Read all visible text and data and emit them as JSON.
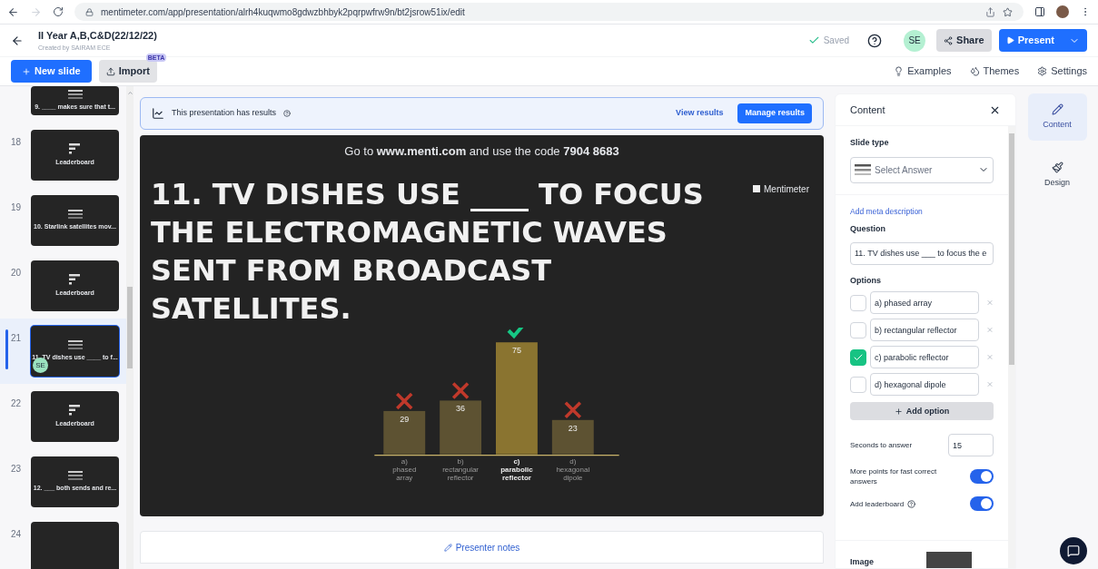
{
  "browser": {
    "url": "mentimeter.com/app/presentation/alrh4kuqwmo8gdwzbhbyk2pqrpwfrw9n/bt2jsrow51ix/edit"
  },
  "header": {
    "title": "II Year A,B,C&D(22/12/22)",
    "subtitle": "Created by SAIRAM ECE",
    "saved": "Saved",
    "avatar": "SE",
    "share": "Share",
    "present": "Present"
  },
  "toolbar": {
    "new_slide": "New slide",
    "import": "Import",
    "import_badge": "BETA",
    "links": [
      "Examples",
      "Themes",
      "Settings"
    ]
  },
  "slides": [
    {
      "title": "9. ____ makes sure that t...",
      "kind": "question",
      "selected": false
    },
    {
      "number": "18",
      "title": "Leaderboard",
      "kind": "leaderboard",
      "selected": false
    },
    {
      "number": "19",
      "title": "10. Starlink satellites mov...",
      "kind": "question",
      "selected": false
    },
    {
      "number": "20",
      "title": "Leaderboard",
      "kind": "leaderboard",
      "selected": false
    },
    {
      "number": "21",
      "title": "11. TV dishes use ____ to f...",
      "kind": "question",
      "selected": true,
      "avatar": "SE"
    },
    {
      "number": "22",
      "title": "Leaderboard",
      "kind": "leaderboard",
      "selected": false
    },
    {
      "number": "23",
      "title": "12. ___ both sends and re...",
      "kind": "question",
      "selected": false
    },
    {
      "number": "24",
      "kind": "blank",
      "selected": false
    }
  ],
  "results_banner": {
    "text": "This presentation has results",
    "view": "View results",
    "manage": "Manage results"
  },
  "slide": {
    "join_prefix": "Go to ",
    "join_site": "www.menti.com",
    "join_mid": " and use the code ",
    "join_code": "7904 8683",
    "brand": "Mentimeter",
    "title": "11. TV DISHES USE ____ TO FOCUS THE ELECTROMAGNETIC WAVES SENT FROM BROADCAST SATELLITES.",
    "markers": [
      {
        "correct": false
      },
      {
        "correct": false
      },
      {
        "correct": true
      },
      {
        "correct": false
      }
    ],
    "chart_data": {
      "type": "bar",
      "categories": [
        "a) phased array",
        "b) rectangular reflector",
        "c) parabolic reflector",
        "d) hexagonal dipole"
      ],
      "values": [
        29,
        36,
        75,
        23
      ],
      "data_labels": true
    }
  },
  "presenter_notes": "Presenter notes",
  "panel": {
    "title": "Content",
    "slide_type_label": "Slide type",
    "slide_type": "Select Answer",
    "meta_link": "Add meta description",
    "question_label": "Question",
    "question": "11. TV dishes use ___ to focus the e",
    "options_label": "Options",
    "options": [
      {
        "text": "a) phased array",
        "checked": false
      },
      {
        "text": "b) rectangular reflector",
        "checked": false
      },
      {
        "text": "c) parabolic reflector",
        "checked": true
      },
      {
        "text": "d) hexagonal dipole",
        "checked": false
      }
    ],
    "add_option": "Add option",
    "seconds_label": "Seconds to answer",
    "seconds": "15",
    "toggles": [
      {
        "label": "More points for fast correct answers",
        "on": true,
        "help": false
      },
      {
        "label": "Add leaderboard",
        "on": true,
        "help": true
      }
    ],
    "image_label": "Image"
  },
  "rail": [
    {
      "label": "Content",
      "selected": true,
      "kind": "pen"
    },
    {
      "label": "Design",
      "selected": false,
      "kind": "design"
    }
  ]
}
